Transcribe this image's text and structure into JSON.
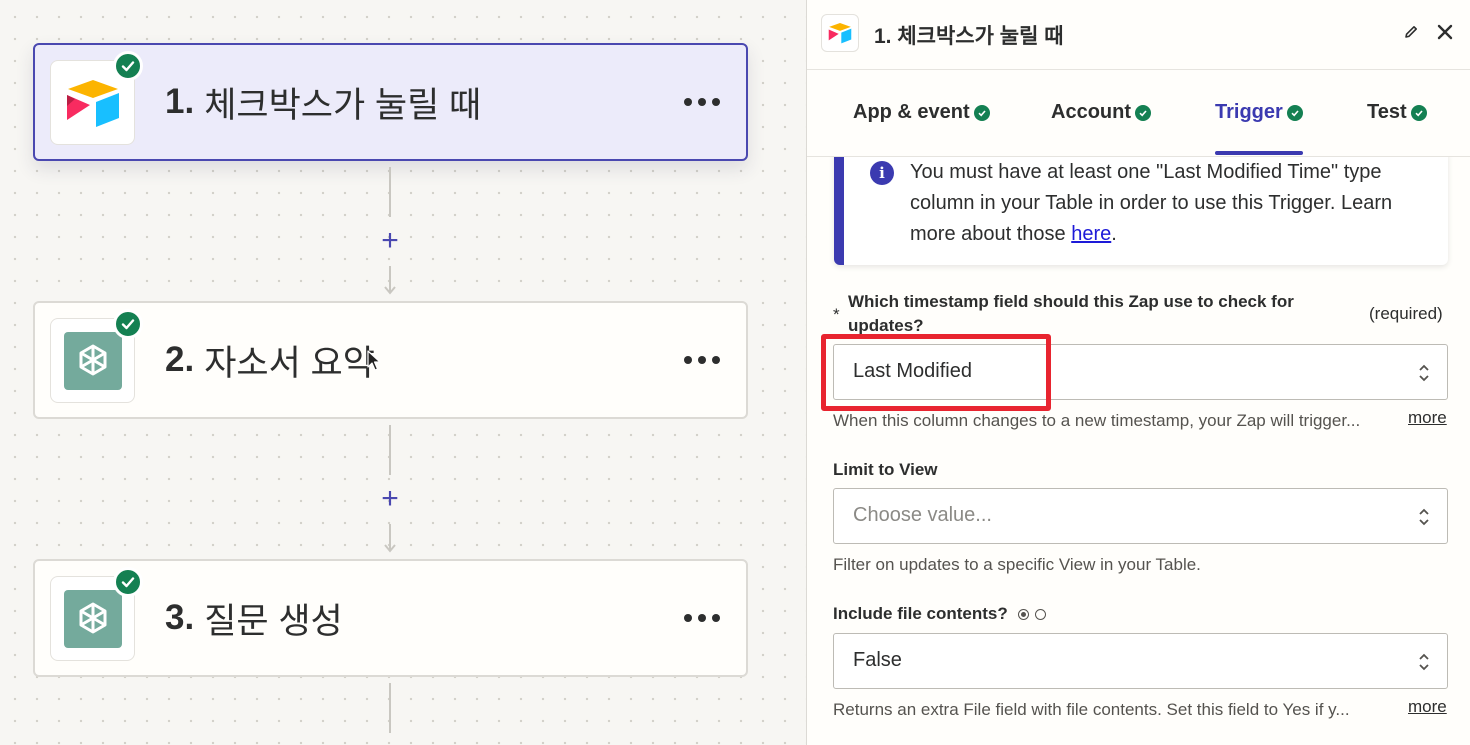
{
  "canvas": {
    "steps": [
      {
        "number": "1.",
        "title": "체크박스가 눌릴 때",
        "app": "airtable-logo"
      },
      {
        "number": "2.",
        "title": "자소서 요약",
        "app": "chatgpt-logo"
      },
      {
        "number": "3.",
        "title": "질문 생성",
        "app": "chatgpt-logo"
      }
    ],
    "add_step_symbol": "+"
  },
  "panel": {
    "title": "1. 체크박스가 눌릴 때",
    "tabs": [
      {
        "label": "App & event"
      },
      {
        "label": "Account"
      },
      {
        "label": "Trigger"
      },
      {
        "label": "Test"
      }
    ],
    "active_tab": "Trigger",
    "info": {
      "text_before": "You must have at least one \"Last Modified Time\" type column in your Table in order to use this Trigger. Learn more about those ",
      "link": "here",
      "text_after": "."
    },
    "fields": {
      "timestamp": {
        "star": "*",
        "label": "Which timestamp field should this Zap use to check for updates?",
        "required": "(required)",
        "value": "Last Modified",
        "helper": "When this column changes to a new timestamp, your Zap will trigger...",
        "more": "more"
      },
      "view": {
        "label": "Limit to View",
        "placeholder": "Choose value...",
        "helper": "Filter on updates to a specific View in your Table."
      },
      "file_contents": {
        "label": "Include file contents?",
        "value": "False",
        "helper": "Returns an extra File field with file contents. Set this field to Yes if y...",
        "more": "more"
      }
    }
  },
  "colors": {
    "accent": "#3b3ab0",
    "success": "#148052",
    "highlight": "#e8242f"
  }
}
